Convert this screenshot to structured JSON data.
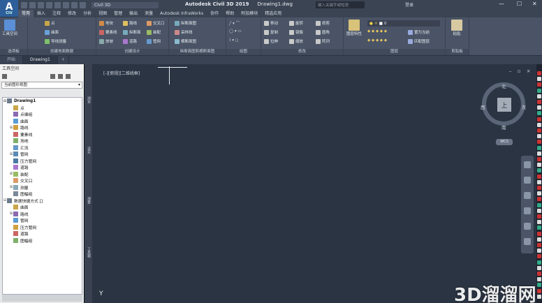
{
  "app": {
    "logo_letter": "A",
    "logo_sub": "CIV",
    "workspace": "Civil 3D"
  },
  "window": {
    "app_name": "Autodesk Civil 3D 2019",
    "file_name": "Drawing1.dwg",
    "search_placeholder": "键入关键字或短语",
    "login": "登录",
    "minimize": "—",
    "restore": "☐",
    "close": "✕"
  },
  "ribbon_tabs": [
    "常用",
    "插入",
    "注释",
    "修改",
    "分析",
    "视图",
    "管理",
    "输出",
    "测量",
    "Autodesk InfraWorks",
    "协作",
    "帮助",
    "附加模块",
    "精选应用"
  ],
  "ribbon": {
    "p1": {
      "title": "选项板",
      "big": "工具空间"
    },
    "p2": {
      "title": "创建地面数据",
      "b1": "点",
      "b2": "曲面",
      "b3": "导线测量"
    },
    "p3": {
      "title": "创建设计",
      "b1": "地块",
      "b2": "要素线",
      "b3": "放坡",
      "b4": "路线",
      "b5": "纵断面",
      "b6": "道路",
      "b7": "交叉口",
      "b8": "装配",
      "b9": "管网"
    },
    "p4": {
      "title": "纵断面图和横断面图",
      "b1": "纵断面图",
      "b2": "采样线",
      "b3": "横断面图"
    },
    "p5": {
      "title": "绘图"
    },
    "p6": {
      "title": "修改",
      "b1": "移动",
      "b2": "旋转",
      "b3": "修剪",
      "b4": "复制",
      "b5": "镜像",
      "b6": "圆角",
      "b7": "拉伸",
      "b8": "缩放",
      "b9": "阵列"
    },
    "p7": {
      "title": "图层",
      "big": "图层特性",
      "layer": "0",
      "b1": "置为当前",
      "b2": "匹配图层"
    },
    "p8": {
      "title": "剪贴板",
      "big": "粘贴"
    }
  },
  "doc_tabs": [
    "开始",
    "Drawing1",
    "+"
  ],
  "toolspace": {
    "title": "工具空间",
    "view": "当前图形视图",
    "tree": [
      {
        "label": "Drawing1",
        "level": 0,
        "toggle": "⊟",
        "bold": true
      },
      {
        "label": "点",
        "level": 1,
        "toggle": ""
      },
      {
        "label": "点编组",
        "level": 1,
        "toggle": ""
      },
      {
        "label": "曲面",
        "level": 1,
        "toggle": ""
      },
      {
        "label": "路线",
        "level": 1,
        "toggle": "⊞"
      },
      {
        "label": "要素线",
        "level": 1,
        "toggle": ""
      },
      {
        "label": "场地",
        "level": 1,
        "toggle": ""
      },
      {
        "label": "汇流",
        "level": 1,
        "toggle": ""
      },
      {
        "label": "管网",
        "level": 1,
        "toggle": "⊞"
      },
      {
        "label": "压力管网",
        "level": 1,
        "toggle": ""
      },
      {
        "label": "道路",
        "level": 1,
        "toggle": ""
      },
      {
        "label": "装配",
        "level": 1,
        "toggle": "⊞"
      },
      {
        "label": "交叉口",
        "level": 1,
        "toggle": ""
      },
      {
        "label": "测量",
        "level": 1,
        "toggle": "⊞"
      },
      {
        "label": "图幅组",
        "level": 1,
        "toggle": ""
      },
      {
        "label": "数据快捷方式 []",
        "level": 0,
        "toggle": "⊟"
      },
      {
        "label": "曲面",
        "level": 1,
        "toggle": ""
      },
      {
        "label": "路线",
        "level": 1,
        "toggle": "⊞"
      },
      {
        "label": "管网",
        "level": 1,
        "toggle": ""
      },
      {
        "label": "压力管网",
        "level": 1,
        "toggle": ""
      },
      {
        "label": "道路",
        "level": 1,
        "toggle": ""
      },
      {
        "label": "图幅组",
        "level": 1,
        "toggle": ""
      }
    ]
  },
  "side_tabs": [
    "浏览",
    "设定",
    "测量",
    "工具箱"
  ],
  "viewport": {
    "label": "[-][俯视][二维线框]",
    "controls": "– ▫ ×"
  },
  "viewcube": {
    "north": "北",
    "south": "南",
    "east": "东",
    "west": "西",
    "top": "上",
    "wcs": "WCS"
  },
  "ucs_label": "Y",
  "watermark": "3D溜溜网"
}
